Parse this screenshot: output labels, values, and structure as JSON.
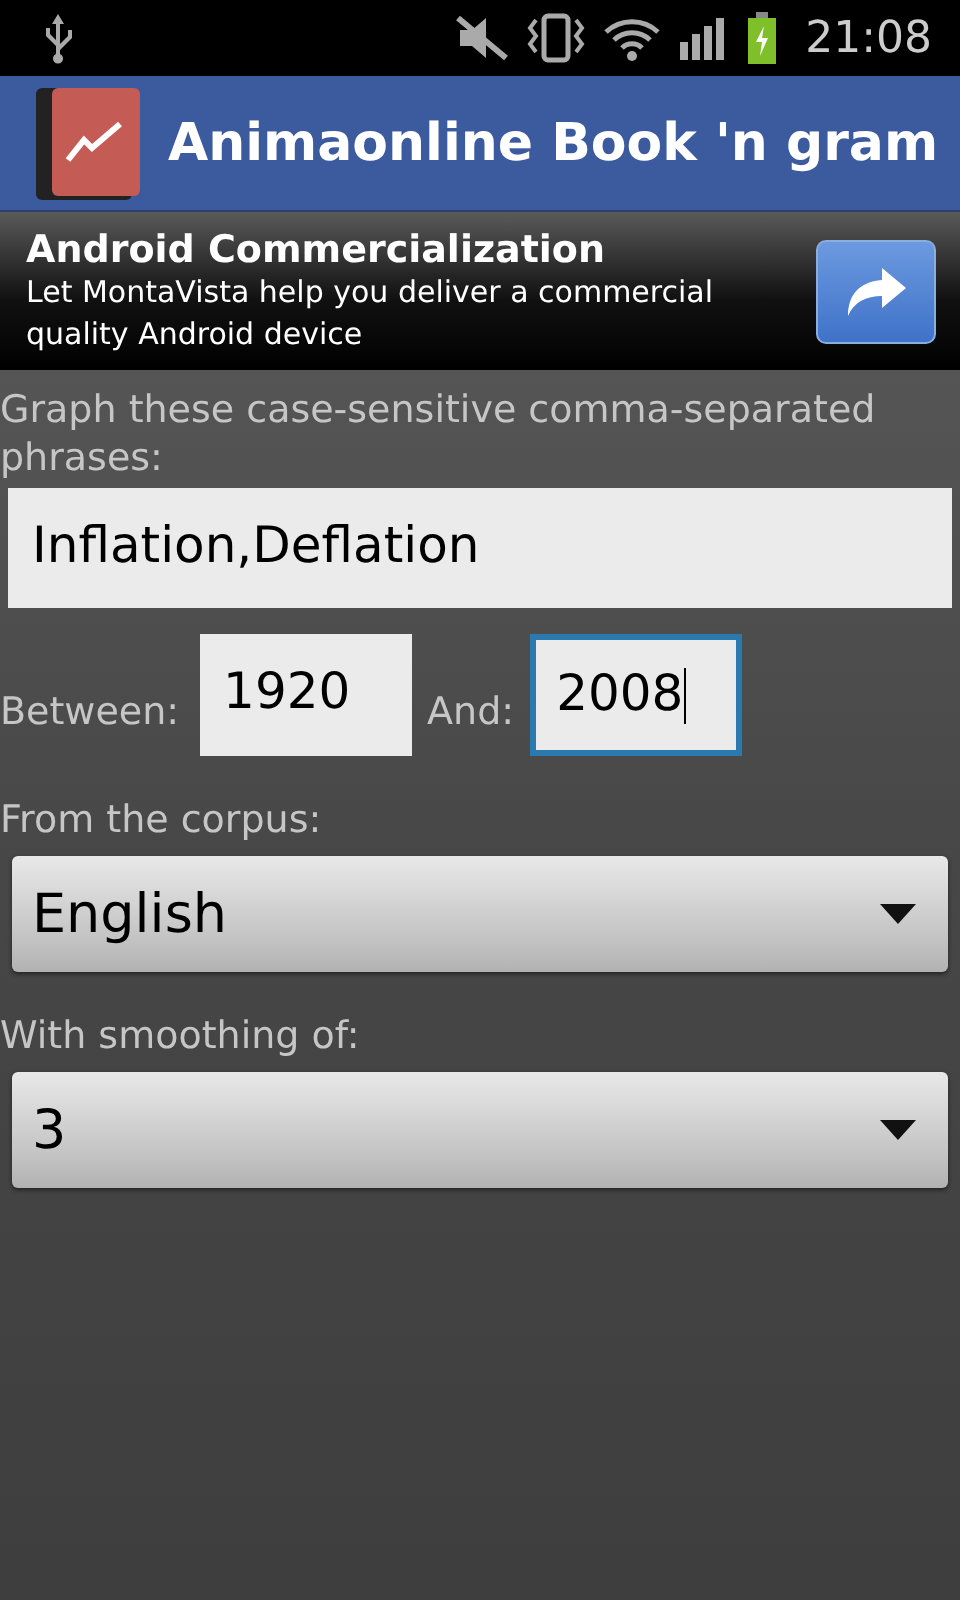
{
  "status_bar": {
    "time": "21:08"
  },
  "app_bar": {
    "title": "Animaonline Book 'n gram"
  },
  "ad": {
    "title": "Android Commercialization",
    "text": "Let MontaVista help you deliver a commercial quality Android device"
  },
  "phrases": {
    "label": "Graph these case-sensitive comma-separated phrases:",
    "value": "Inflation,Deflation",
    "focused": false
  },
  "range": [
    {
      "label": "Between:",
      "value": "1920",
      "focused": false
    },
    {
      "label": "And:",
      "value": "2008",
      "focused": true
    }
  ],
  "spinners": [
    {
      "label": "From the corpus:",
      "value": "English"
    },
    {
      "label": "With smoothing of:",
      "value": "3"
    }
  ]
}
